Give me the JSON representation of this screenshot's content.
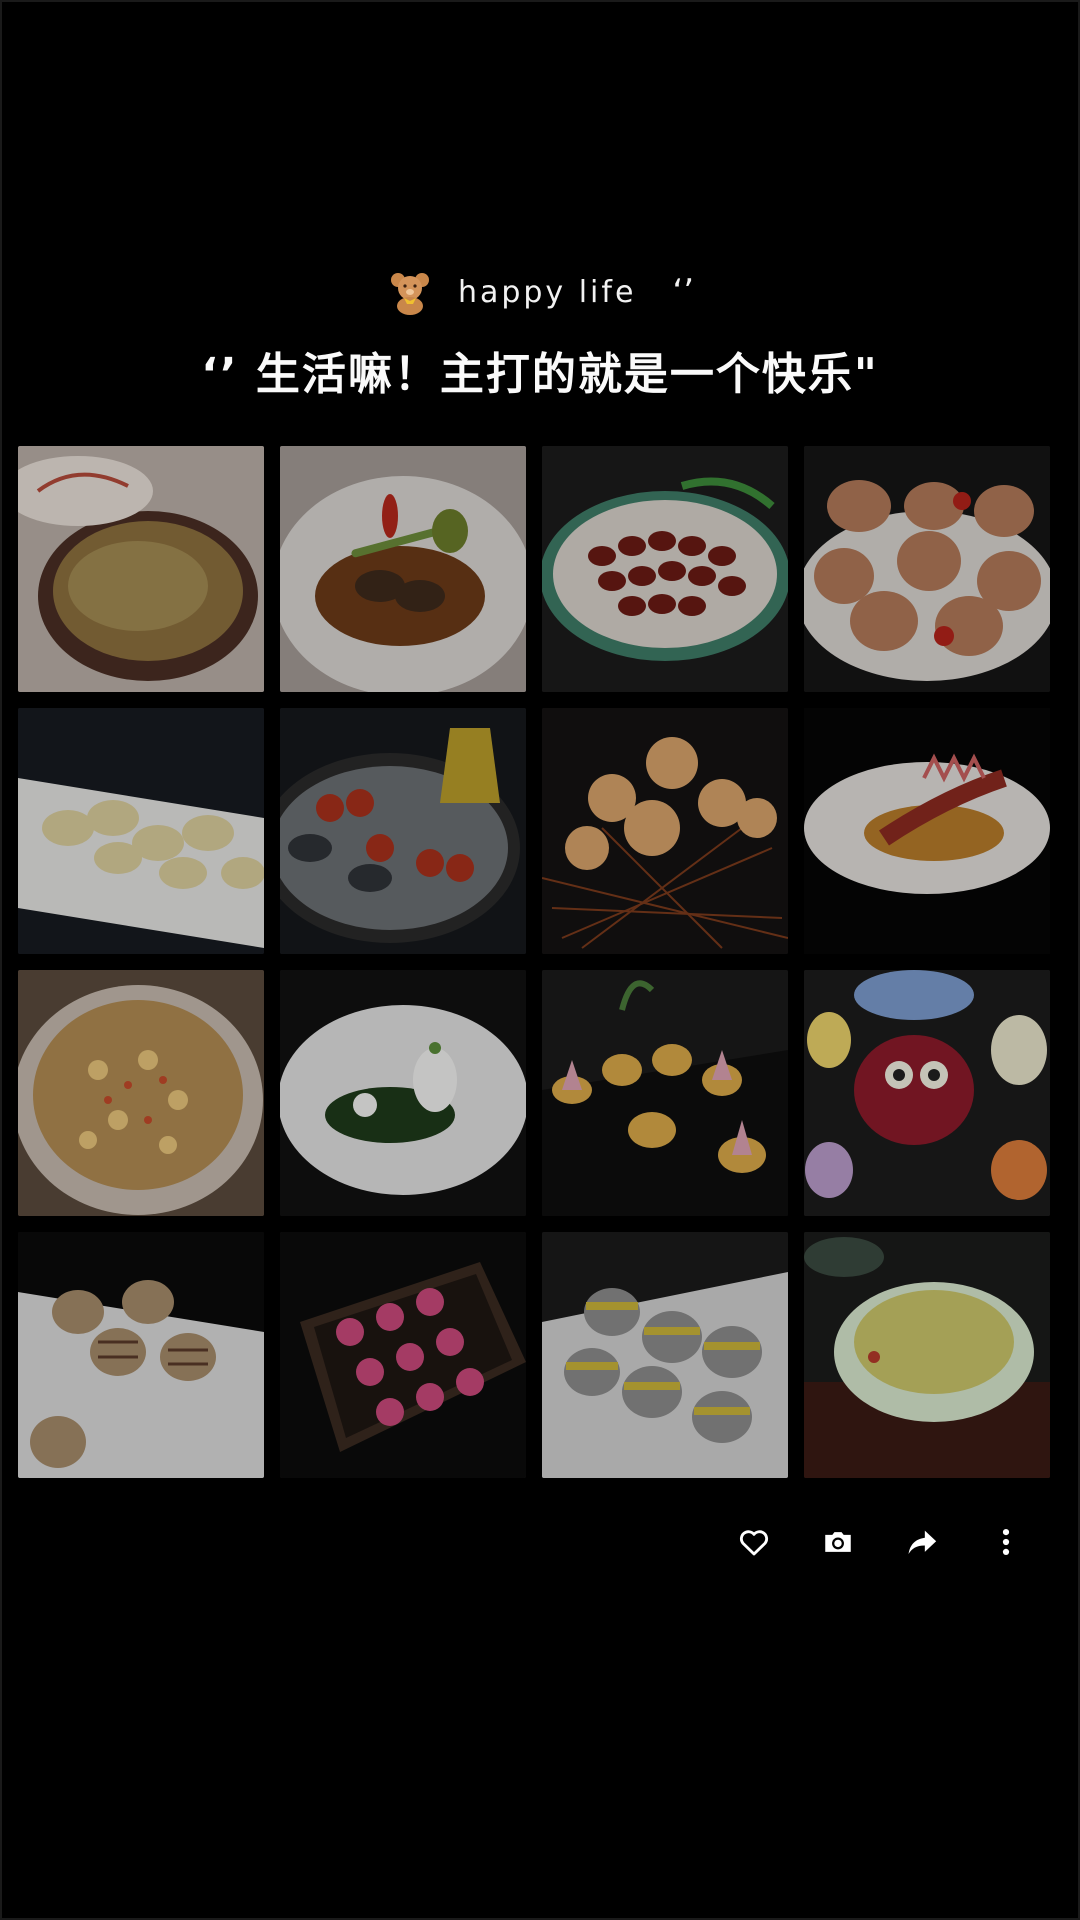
{
  "header": {
    "caption": "happy life",
    "caption_quote": "‘’",
    "headline": "‘’ 生活嘛！主打的就是一个快乐\""
  },
  "photos": [
    {
      "icon": "clay-pot-dish-photo"
    },
    {
      "icon": "abalone-sauce-photo"
    },
    {
      "icon": "braised-slices-photo"
    },
    {
      "icon": "pastry-buns-photo"
    },
    {
      "icon": "white-dumplings-photo"
    },
    {
      "icon": "cherry-tomato-plate-photo"
    },
    {
      "icon": "fried-puffs-photo"
    },
    {
      "icon": "sliced-duck-photo"
    },
    {
      "icon": "rice-claypot-photo"
    },
    {
      "icon": "white-bowl-photo"
    },
    {
      "icon": "mini-pastries-photo"
    },
    {
      "icon": "animal-pastries-photo"
    },
    {
      "icon": "striped-pastries-photo"
    },
    {
      "icon": "pink-flower-pastries-photo"
    },
    {
      "icon": "grey-yellow-pastries-photo"
    },
    {
      "icon": "soup-bowl-photo"
    }
  ],
  "actions": [
    {
      "icon": "heart-icon"
    },
    {
      "icon": "camera-icon"
    },
    {
      "icon": "share-icon"
    },
    {
      "icon": "more-icon"
    }
  ]
}
